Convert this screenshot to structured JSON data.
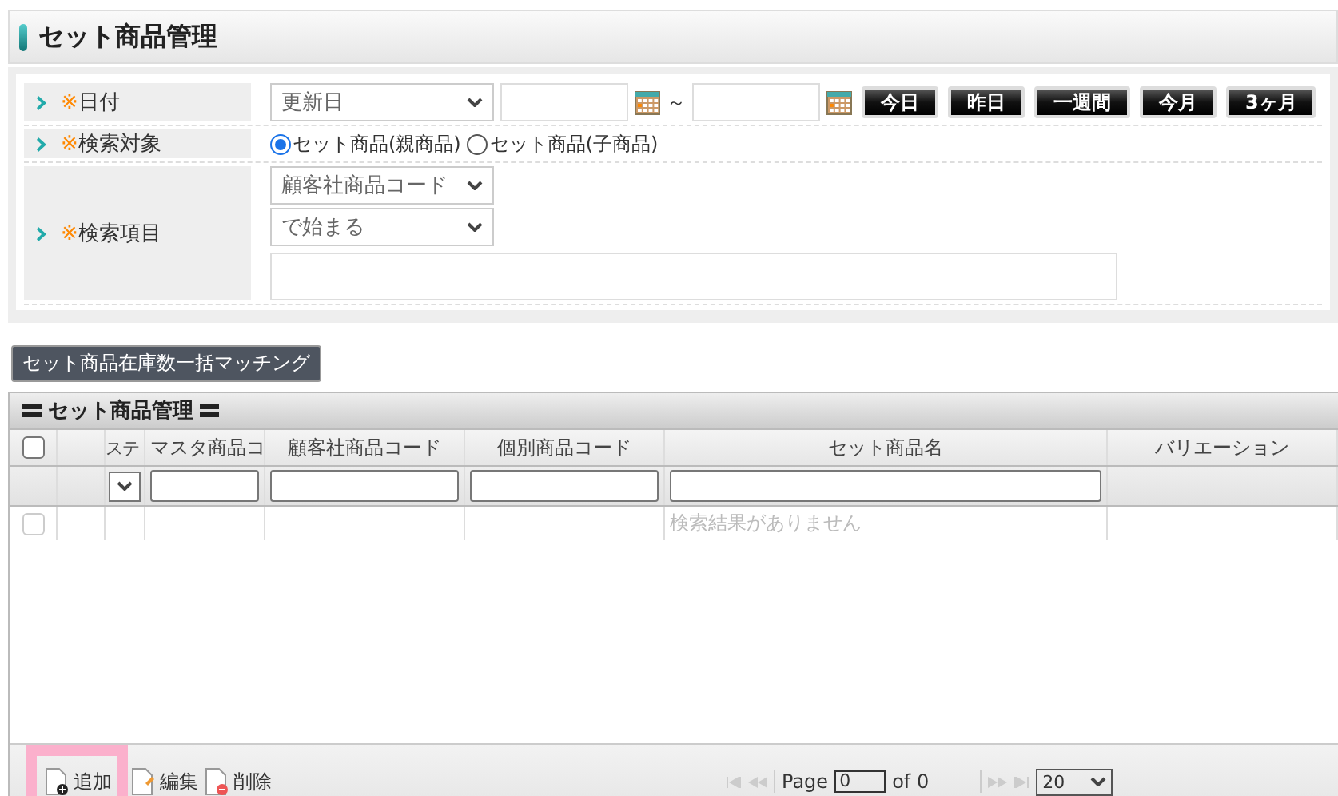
{
  "page_title": "セット商品管理",
  "search": {
    "rows": [
      {
        "kind": "date",
        "mark": "※",
        "label": "日付",
        "select": "更新日",
        "tilde": "～",
        "quick_buttons": [
          "今日",
          "昨日",
          "一週間",
          "今月",
          "3ヶ月"
        ]
      },
      {
        "kind": "radio",
        "mark": "※",
        "label": "検索対象",
        "options": [
          {
            "label": "セット商品(親商品)",
            "selected": true
          },
          {
            "label": "セット商品(子商品)",
            "selected": false
          }
        ]
      },
      {
        "kind": "item",
        "mark": "※",
        "label": "検索項目",
        "selects": [
          "顧客社商品コード",
          "で始まる"
        ]
      }
    ]
  },
  "matching_button": "セット商品在庫数一括マッチング",
  "grid": {
    "title": "セット商品管理",
    "columns": [
      {
        "kind": "checkbox",
        "checked": false
      },
      {
        "kind": "blank"
      },
      {
        "kind": "text",
        "label": "ステ",
        "filter": {
          "kind": "select"
        }
      },
      {
        "kind": "text",
        "label": "マスタ商品コ",
        "filter": {
          "kind": "input"
        }
      },
      {
        "kind": "text",
        "label": "顧客社商品コード",
        "filter": {
          "kind": "input"
        }
      },
      {
        "kind": "text",
        "label": "個別商品コード",
        "filter": {
          "kind": "input"
        }
      },
      {
        "kind": "text",
        "label": "セット商品名",
        "filter": {
          "kind": "input"
        }
      },
      {
        "kind": "text",
        "label": "バリエーション"
      }
    ],
    "empty_row": {
      "checked": false,
      "message": "検索結果がありません"
    },
    "actions": [
      {
        "kind": "add",
        "label": "追加",
        "highlighted": true
      },
      {
        "kind": "edit",
        "label": "編集",
        "highlighted": false
      },
      {
        "kind": "delete",
        "label": "削除",
        "highlighted": false
      }
    ],
    "pager": {
      "page_label": "Page",
      "page": "0",
      "of": "of 0",
      "page_size": "20"
    }
  }
}
